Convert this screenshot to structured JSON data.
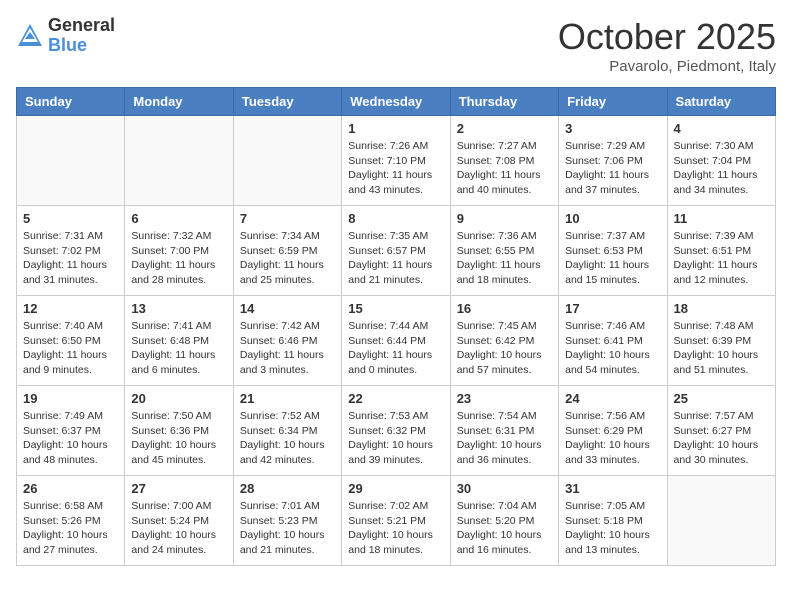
{
  "header": {
    "logo_general": "General",
    "logo_blue": "Blue",
    "month_title": "October 2025",
    "subtitle": "Pavarolo, Piedmont, Italy"
  },
  "days_of_week": [
    "Sunday",
    "Monday",
    "Tuesday",
    "Wednesday",
    "Thursday",
    "Friday",
    "Saturday"
  ],
  "weeks": [
    [
      {
        "day": "",
        "info": ""
      },
      {
        "day": "",
        "info": ""
      },
      {
        "day": "",
        "info": ""
      },
      {
        "day": "1",
        "info": "Sunrise: 7:26 AM\nSunset: 7:10 PM\nDaylight: 11 hours and 43 minutes."
      },
      {
        "day": "2",
        "info": "Sunrise: 7:27 AM\nSunset: 7:08 PM\nDaylight: 11 hours and 40 minutes."
      },
      {
        "day": "3",
        "info": "Sunrise: 7:29 AM\nSunset: 7:06 PM\nDaylight: 11 hours and 37 minutes."
      },
      {
        "day": "4",
        "info": "Sunrise: 7:30 AM\nSunset: 7:04 PM\nDaylight: 11 hours and 34 minutes."
      }
    ],
    [
      {
        "day": "5",
        "info": "Sunrise: 7:31 AM\nSunset: 7:02 PM\nDaylight: 11 hours and 31 minutes."
      },
      {
        "day": "6",
        "info": "Sunrise: 7:32 AM\nSunset: 7:00 PM\nDaylight: 11 hours and 28 minutes."
      },
      {
        "day": "7",
        "info": "Sunrise: 7:34 AM\nSunset: 6:59 PM\nDaylight: 11 hours and 25 minutes."
      },
      {
        "day": "8",
        "info": "Sunrise: 7:35 AM\nSunset: 6:57 PM\nDaylight: 11 hours and 21 minutes."
      },
      {
        "day": "9",
        "info": "Sunrise: 7:36 AM\nSunset: 6:55 PM\nDaylight: 11 hours and 18 minutes."
      },
      {
        "day": "10",
        "info": "Sunrise: 7:37 AM\nSunset: 6:53 PM\nDaylight: 11 hours and 15 minutes."
      },
      {
        "day": "11",
        "info": "Sunrise: 7:39 AM\nSunset: 6:51 PM\nDaylight: 11 hours and 12 minutes."
      }
    ],
    [
      {
        "day": "12",
        "info": "Sunrise: 7:40 AM\nSunset: 6:50 PM\nDaylight: 11 hours and 9 minutes."
      },
      {
        "day": "13",
        "info": "Sunrise: 7:41 AM\nSunset: 6:48 PM\nDaylight: 11 hours and 6 minutes."
      },
      {
        "day": "14",
        "info": "Sunrise: 7:42 AM\nSunset: 6:46 PM\nDaylight: 11 hours and 3 minutes."
      },
      {
        "day": "15",
        "info": "Sunrise: 7:44 AM\nSunset: 6:44 PM\nDaylight: 11 hours and 0 minutes."
      },
      {
        "day": "16",
        "info": "Sunrise: 7:45 AM\nSunset: 6:42 PM\nDaylight: 10 hours and 57 minutes."
      },
      {
        "day": "17",
        "info": "Sunrise: 7:46 AM\nSunset: 6:41 PM\nDaylight: 10 hours and 54 minutes."
      },
      {
        "day": "18",
        "info": "Sunrise: 7:48 AM\nSunset: 6:39 PM\nDaylight: 10 hours and 51 minutes."
      }
    ],
    [
      {
        "day": "19",
        "info": "Sunrise: 7:49 AM\nSunset: 6:37 PM\nDaylight: 10 hours and 48 minutes."
      },
      {
        "day": "20",
        "info": "Sunrise: 7:50 AM\nSunset: 6:36 PM\nDaylight: 10 hours and 45 minutes."
      },
      {
        "day": "21",
        "info": "Sunrise: 7:52 AM\nSunset: 6:34 PM\nDaylight: 10 hours and 42 minutes."
      },
      {
        "day": "22",
        "info": "Sunrise: 7:53 AM\nSunset: 6:32 PM\nDaylight: 10 hours and 39 minutes."
      },
      {
        "day": "23",
        "info": "Sunrise: 7:54 AM\nSunset: 6:31 PM\nDaylight: 10 hours and 36 minutes."
      },
      {
        "day": "24",
        "info": "Sunrise: 7:56 AM\nSunset: 6:29 PM\nDaylight: 10 hours and 33 minutes."
      },
      {
        "day": "25",
        "info": "Sunrise: 7:57 AM\nSunset: 6:27 PM\nDaylight: 10 hours and 30 minutes."
      }
    ],
    [
      {
        "day": "26",
        "info": "Sunrise: 6:58 AM\nSunset: 5:26 PM\nDaylight: 10 hours and 27 minutes."
      },
      {
        "day": "27",
        "info": "Sunrise: 7:00 AM\nSunset: 5:24 PM\nDaylight: 10 hours and 24 minutes."
      },
      {
        "day": "28",
        "info": "Sunrise: 7:01 AM\nSunset: 5:23 PM\nDaylight: 10 hours and 21 minutes."
      },
      {
        "day": "29",
        "info": "Sunrise: 7:02 AM\nSunset: 5:21 PM\nDaylight: 10 hours and 18 minutes."
      },
      {
        "day": "30",
        "info": "Sunrise: 7:04 AM\nSunset: 5:20 PM\nDaylight: 10 hours and 16 minutes."
      },
      {
        "day": "31",
        "info": "Sunrise: 7:05 AM\nSunset: 5:18 PM\nDaylight: 10 hours and 13 minutes."
      },
      {
        "day": "",
        "info": ""
      }
    ]
  ]
}
